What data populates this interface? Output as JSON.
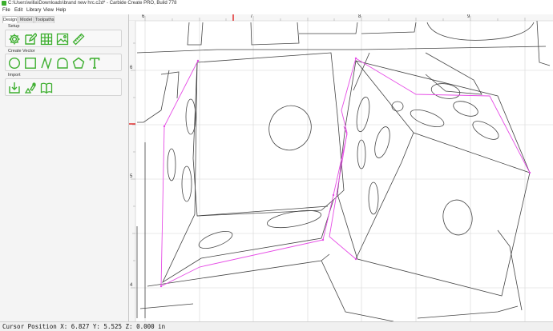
{
  "window": {
    "title": "C:\\Users\\willa\\Downloads\\brand new hrc.c2d* - Carbide Create PRO, Build 778"
  },
  "menu": {
    "items": [
      "File",
      "Edit",
      "Library",
      "View",
      "Help"
    ]
  },
  "sidebar": {
    "tabs": [
      "Design",
      "Model",
      "Toolpaths"
    ],
    "active_tab": "Design",
    "sections": [
      {
        "label": "Setup",
        "tools": [
          "gear-icon",
          "edit-document-icon",
          "grid-icon",
          "image-icon",
          "ruler-icon"
        ]
      },
      {
        "label": "Create Vector",
        "tools": [
          "circle-icon",
          "rectangle-icon",
          "curve-icon",
          "polyline-icon",
          "polygon-icon",
          "text-icon"
        ]
      },
      {
        "label": "Import",
        "tools": [
          "import-icon",
          "import-shapes-icon",
          "library-icon"
        ]
      }
    ],
    "accent_color": "#3cae2e"
  },
  "canvas": {
    "ruler_top_labels": [
      "6",
      "7",
      "8",
      "9"
    ],
    "ruler_left_labels": [
      "6",
      "5",
      "4"
    ],
    "selection_color": "#e64ce6",
    "marker_color": "#e02020"
  },
  "status": {
    "cursor_position": "Cursor Position X: 6.827 Y: 5.525 Z: 0.000 in"
  }
}
